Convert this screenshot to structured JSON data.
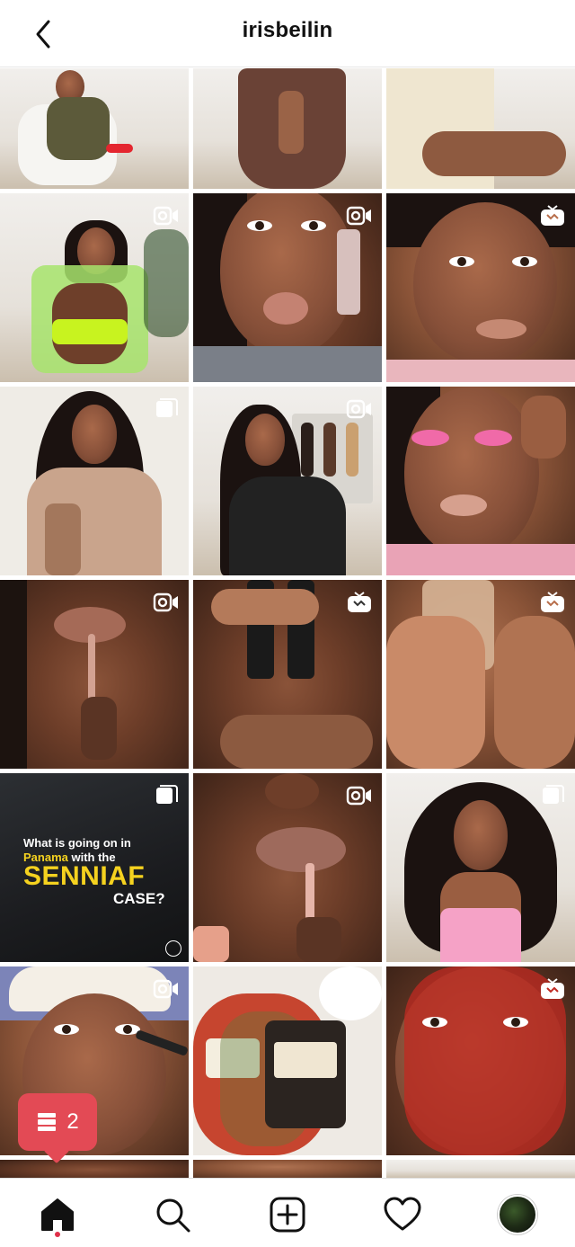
{
  "header": {
    "username": "irisbeilin",
    "back_icon": "chevron-left-icon"
  },
  "grid": {
    "tiles": [
      {
        "row": 1,
        "col": 1,
        "badge": "none"
      },
      {
        "row": 1,
        "col": 2,
        "badge": "none"
      },
      {
        "row": 1,
        "col": 3,
        "badge": "none"
      },
      {
        "row": 2,
        "col": 1,
        "badge": "reel-icon"
      },
      {
        "row": 2,
        "col": 2,
        "badge": "reel-icon"
      },
      {
        "row": 2,
        "col": 3,
        "badge": "igtv-icon"
      },
      {
        "row": 3,
        "col": 1,
        "badge": "carousel-icon"
      },
      {
        "row": 3,
        "col": 2,
        "badge": "reel-icon"
      },
      {
        "row": 3,
        "col": 3,
        "badge": "none"
      },
      {
        "row": 4,
        "col": 1,
        "badge": "reel-icon"
      },
      {
        "row": 4,
        "col": 2,
        "badge": "igtv-icon"
      },
      {
        "row": 4,
        "col": 3,
        "badge": "igtv-icon"
      },
      {
        "row": 5,
        "col": 1,
        "badge": "carousel-icon"
      },
      {
        "row": 5,
        "col": 2,
        "badge": "reel-icon"
      },
      {
        "row": 5,
        "col": 3,
        "badge": "carousel-icon"
      },
      {
        "row": 6,
        "col": 1,
        "badge": "reel-icon"
      },
      {
        "row": 6,
        "col": 2,
        "badge": "reel-icon"
      },
      {
        "row": 6,
        "col": 3,
        "badge": "igtv-icon"
      }
    ],
    "panama_post": {
      "line1": "What is going on in",
      "line2_highlight": "Panama",
      "line2_rest": " with the",
      "headline": "SENNIAF",
      "tail": "CASE?"
    }
  },
  "notification": {
    "icon": "feed-posts-icon",
    "count": "2",
    "color": "#e34a55"
  },
  "bottom_nav": {
    "items": [
      {
        "name": "home",
        "icon": "home-icon",
        "active": true
      },
      {
        "name": "search",
        "icon": "search-icon",
        "active": false
      },
      {
        "name": "create",
        "icon": "add-post-icon",
        "active": false
      },
      {
        "name": "activity",
        "icon": "heart-icon",
        "active": false
      },
      {
        "name": "profile",
        "icon": "avatar",
        "active": false
      }
    ],
    "active_dot_color": "#e0304a"
  }
}
